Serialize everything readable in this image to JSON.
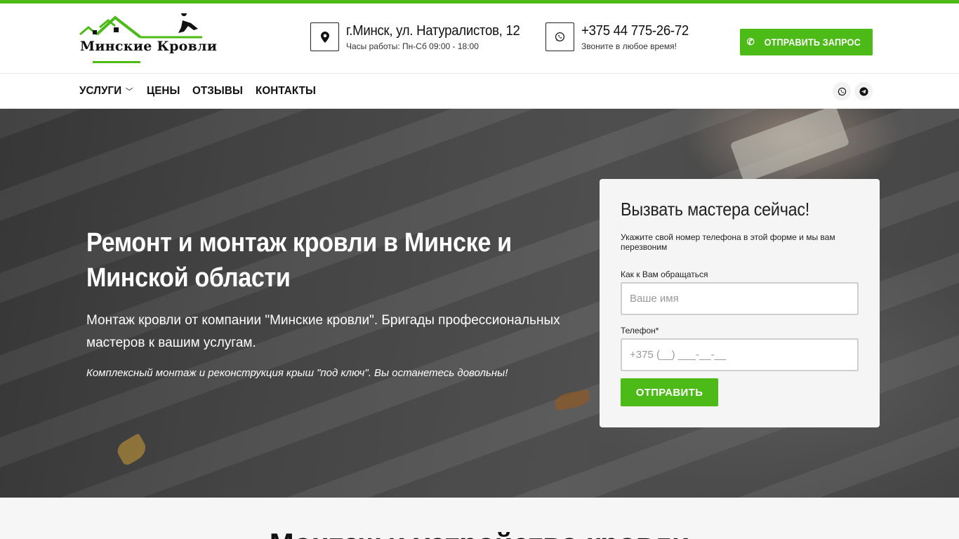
{
  "brand": {
    "name": "Минские Кровли",
    "accent": "#4cbb17"
  },
  "header": {
    "address": {
      "icon": "map-marker-icon",
      "title": "г.Минск, ул. Натуралистов, 12",
      "subtitle": "Часы работы: Пн-Сб 09:00 - 18:00"
    },
    "phone": {
      "icon": "whatsapp-icon",
      "title": "+375 44 775-26-72",
      "subtitle": "Звоните в любое время!"
    },
    "cta": {
      "icon": "phone-icon",
      "label": "ОТПРАВИТЬ ЗАПРОС"
    }
  },
  "nav": {
    "items": [
      {
        "label": "УСЛУГИ",
        "has_dropdown": true
      },
      {
        "label": "ЦЕНЫ"
      },
      {
        "label": "ОТЗЫВЫ"
      },
      {
        "label": "КОНТАКТЫ"
      }
    ],
    "social": [
      "whatsapp-icon",
      "telegram-icon"
    ]
  },
  "hero": {
    "title": "Ремонт и монтаж кровли в Минске и Минской области",
    "lead": "Монтаж кровли от компании \"Минские кровли\". Бригады профессиональных мастеров к вашим услугам.",
    "note": "Комплексный монтаж и реконструкция крыш \"под ключ\". Вы останетесь довольны!"
  },
  "form": {
    "title": "Вызвать мастера сейчас!",
    "description": "Укажите свой номер телефона в этой форме и мы вам перезвоним",
    "name_label": "Как к Вам обращаться",
    "name_placeholder": "Ваше имя",
    "phone_label": "Телефон*",
    "phone_placeholder": "+375 (__) ___-__-__",
    "submit_label": "ОТПРАВИТЬ"
  },
  "section": {
    "title": "Монтаж и устройство кровли"
  }
}
